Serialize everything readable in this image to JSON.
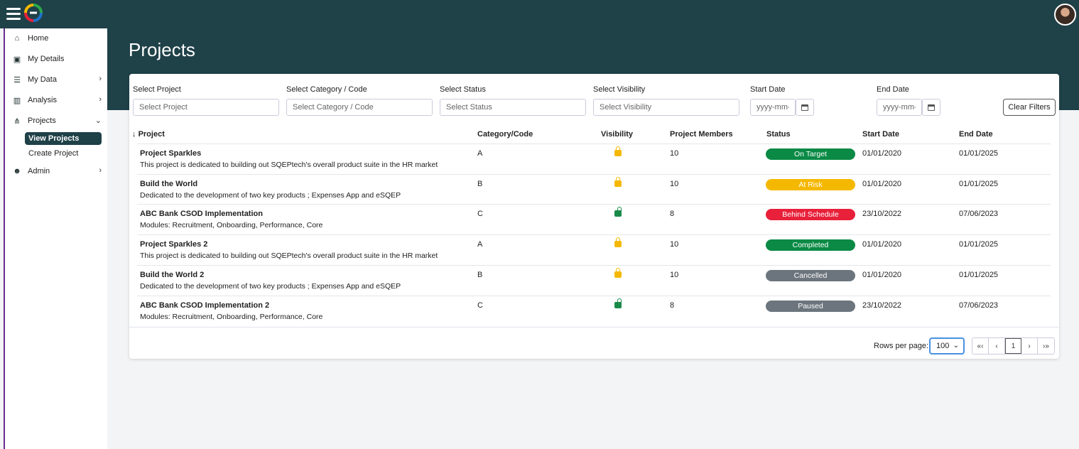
{
  "sidebar": {
    "items": [
      {
        "label": "Home",
        "icon": "home-icon"
      },
      {
        "label": "My Details",
        "icon": "id-card-icon"
      },
      {
        "label": "My Data",
        "icon": "database-icon"
      },
      {
        "label": "Analysis",
        "icon": "chart-icon"
      },
      {
        "label": "Projects",
        "icon": "projects-icon"
      },
      {
        "label": "Admin",
        "icon": "users-icon"
      }
    ],
    "sub_items": [
      {
        "label": "View Projects"
      },
      {
        "label": "Create Project"
      }
    ]
  },
  "page": {
    "title": "Projects"
  },
  "filters": {
    "project": {
      "label": "Select Project",
      "placeholder": "Select Project"
    },
    "category": {
      "label": "Select Category / Code",
      "placeholder": "Select Category / Code"
    },
    "status": {
      "label": "Select Status",
      "placeholder": "Select Status"
    },
    "visibility": {
      "label": "Select Visibility",
      "placeholder": "Select Visibility"
    },
    "start_date": {
      "label": "Start Date",
      "placeholder": "yyyy-mm-"
    },
    "end_date": {
      "label": "End Date",
      "placeholder": "yyyy-mm-"
    },
    "clear_label": "Clear Filters"
  },
  "table": {
    "columns": [
      "Project",
      "Category/Code",
      "Visibility",
      "Project Members",
      "Status",
      "Start Date",
      "End Date"
    ],
    "sort_indicator": "↓",
    "rows": [
      {
        "name": "Project Sparkles",
        "desc": "This project is dedicated to building out SQEPtech's overall product suite in the HR market",
        "category": "A",
        "visibility": "locked",
        "members": "10",
        "status": "On Target",
        "status_color": "#0a8a45",
        "start": "01/01/2020",
        "end": "01/01/2025"
      },
      {
        "name": "Build the World",
        "desc": "Dedicated to the development of two key products ; Expenses App and eSQEP",
        "category": "B",
        "visibility": "locked",
        "members": "10",
        "status": "At Risk",
        "status_color": "#f5b800",
        "start": "01/01/2020",
        "end": "01/01/2025"
      },
      {
        "name": "ABC Bank CSOD Implementation",
        "desc": "Modules: Recruitment, Onboarding, Performance, Core",
        "category": "C",
        "visibility": "open",
        "members": "8",
        "status": "Behind Schedule",
        "status_color": "#e8203a",
        "start": "23/10/2022",
        "end": "07/06/2023"
      },
      {
        "name": "Project Sparkles 2",
        "desc": "This project is dedicated to building out SQEPtech's overall product suite in the HR market",
        "category": "A",
        "visibility": "locked",
        "members": "10",
        "status": "Completed",
        "status_color": "#0a8a45",
        "start": "01/01/2020",
        "end": "01/01/2025"
      },
      {
        "name": "Build the World 2",
        "desc": "Dedicated to the development of two key products ; Expenses App and eSQEP",
        "category": "B",
        "visibility": "locked",
        "members": "10",
        "status": "Cancelled",
        "status_color": "#6c757d",
        "start": "01/01/2020",
        "end": "01/01/2025"
      },
      {
        "name": "ABC Bank CSOD Implementation 2",
        "desc": "Modules: Recruitment, Onboarding, Performance, Core",
        "category": "C",
        "visibility": "open",
        "members": "8",
        "status": "Paused",
        "status_color": "#6c757d",
        "start": "23/10/2022",
        "end": "07/06/2023"
      }
    ]
  },
  "pagination": {
    "rows_per_page_label": "Rows per page:",
    "rows_per_page": "100",
    "first": "«‹",
    "prev": "‹",
    "page": "1",
    "next": "›",
    "last": "›»"
  }
}
